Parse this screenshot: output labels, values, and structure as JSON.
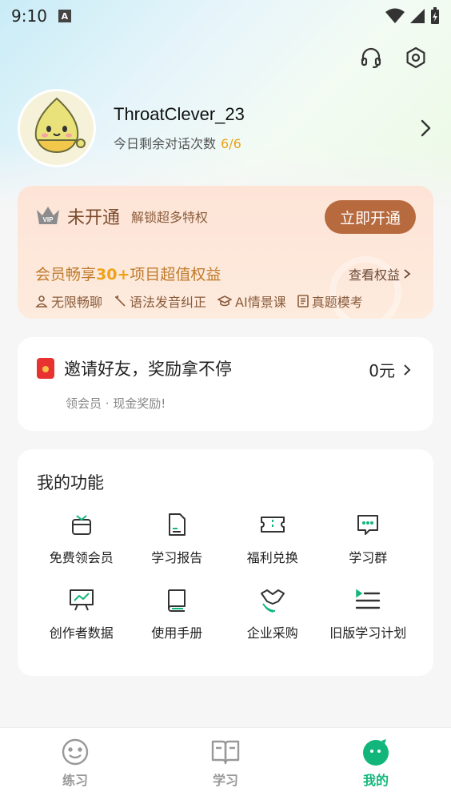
{
  "status_bar": {
    "time": "9:10",
    "notification_letter": "A"
  },
  "profile": {
    "username": "ThroatClever_23",
    "chat_label": "今日剩余对话次数",
    "chat_count": "6/6"
  },
  "vip": {
    "badge": "VIP",
    "status": "未开通",
    "unlock_text": "解锁超多特权",
    "open_button": "立即开通",
    "benefit_prefix": "会员畅享",
    "benefit_highlight": "30+",
    "benefit_suffix": "项目超值权益",
    "view_benefits": "查看权益",
    "features": [
      "无限畅聊",
      "语法发音纠正",
      "AI情景课",
      "真题模考"
    ]
  },
  "invite": {
    "title": "邀请好友，奖励拿不停",
    "amount": "0元",
    "subtitle": "领会员 · 现金奖励!"
  },
  "functions": {
    "title": "我的功能",
    "items": [
      {
        "label": "免费领会员",
        "icon": "gift-icon"
      },
      {
        "label": "学习报告",
        "icon": "report-icon"
      },
      {
        "label": "福利兑换",
        "icon": "ticket-icon"
      },
      {
        "label": "学习群",
        "icon": "chat-group-icon"
      },
      {
        "label": "创作者数据",
        "icon": "chart-board-icon"
      },
      {
        "label": "使用手册",
        "icon": "book-icon"
      },
      {
        "label": "企业采购",
        "icon": "handshake-icon"
      },
      {
        "label": "旧版学习计划",
        "icon": "list-icon"
      }
    ]
  },
  "nav": {
    "items": [
      {
        "label": "练习",
        "icon": "smile-icon"
      },
      {
        "label": "学习",
        "icon": "open-book-icon"
      },
      {
        "label": "我的",
        "icon": "mascot-icon"
      }
    ],
    "active_index": 2
  },
  "colors": {
    "accent": "#13b67a",
    "vip_button": "#b76a3e",
    "highlight": "#f0a118"
  }
}
